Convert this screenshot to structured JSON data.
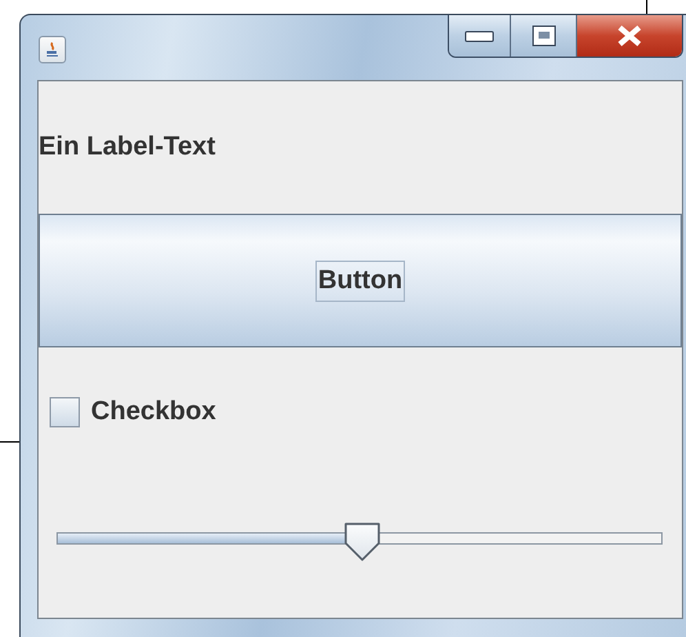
{
  "label": {
    "text": "Ein Label-Text"
  },
  "button": {
    "label": "Button"
  },
  "checkbox": {
    "label": "Checkbox",
    "checked": false
  },
  "slider": {
    "level": 0.505
  }
}
